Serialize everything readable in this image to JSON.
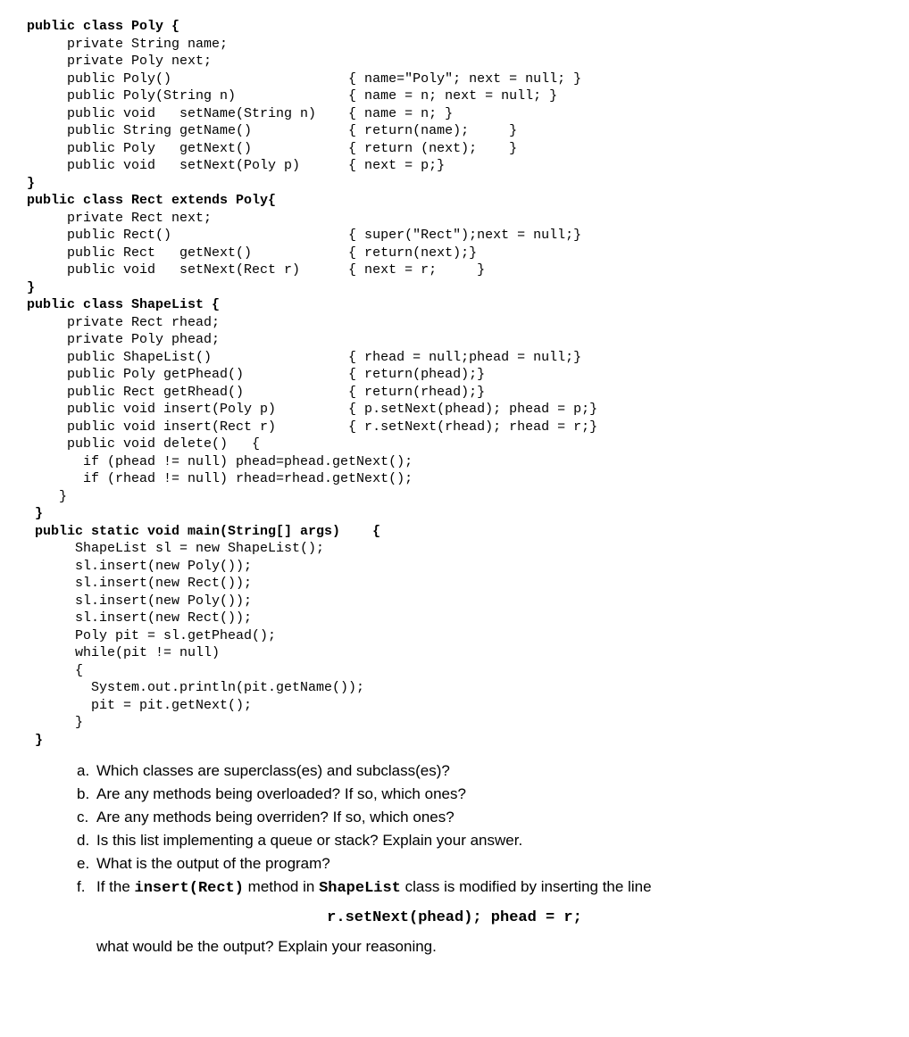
{
  "code": {
    "l1": "public class Poly {",
    "l2": "     private String name;",
    "l3": "     private Poly next;",
    "l4": "     public Poly()                      { name=\"Poly\"; next = null; }",
    "l5": "     public Poly(String n)              { name = n; next = null; }",
    "l6": "     public void   setName(String n)    { name = n; }",
    "l7": "     public String getName()            { return(name);     }",
    "l8": "     public Poly   getNext()            { return (next);    }",
    "l9": "     public void   setNext(Poly p)      { next = p;}",
    "l10": "}",
    "l11": "public class Rect extends Poly{",
    "l12": "     private Rect next;",
    "l13": "     public Rect()                      { super(\"Rect\");next = null;}",
    "l14": "     public Rect   getNext()            { return(next);}",
    "l15": "     public void   setNext(Rect r)      { next = r;     }",
    "l16": "}",
    "l17": "public class ShapeList {",
    "l18": "     private Rect rhead;",
    "l19": "     private Poly phead;",
    "l20": "     public ShapeList()                 { rhead = null;phead = null;}",
    "l21": "     public Poly getPhead()             { return(phead);}",
    "l22": "     public Rect getRhead()             { return(rhead);}",
    "l23": "     public void insert(Poly p)         { p.setNext(phead); phead = p;}",
    "l24": "     public void insert(Rect r)         { r.setNext(rhead); rhead = r;}",
    "l25": "     public void delete()   {",
    "l26": "       if (phead != null) phead=phead.getNext();",
    "l27": "       if (rhead != null) rhead=rhead.getNext();",
    "l28": "    }",
    "l29": " }",
    "l30": " public static void main(String[] args)    {",
    "l31": "      ShapeList sl = new ShapeList();",
    "l32": "      sl.insert(new Poly());",
    "l33": "      sl.insert(new Rect());",
    "l34": "      sl.insert(new Poly());",
    "l35": "      sl.insert(new Rect());",
    "l36": "      Poly pit = sl.getPhead();",
    "l37": "      while(pit != null)",
    "l38": "      {",
    "l39": "        System.out.println(pit.getName());",
    "l40": "        pit = pit.getNext();",
    "l41": "      }",
    "l42": " }"
  },
  "questions": {
    "a": {
      "letter": "a.",
      "text": "Which classes are superclass(es) and subclass(es)?"
    },
    "b": {
      "letter": "b.",
      "text": "Are any methods being overloaded? If so, which ones?"
    },
    "c": {
      "letter": "c.",
      "text": "Are any methods being overriden? If so, which ones?"
    },
    "d": {
      "letter": "d.",
      "text": "Is this list implementing a queue or stack? Explain your answer."
    },
    "e": {
      "letter": "e.",
      "text": "What is the output of the program?"
    },
    "f": {
      "letter": "f.",
      "pre": "If the ",
      "code1": "insert(Rect)",
      "mid": " method in ",
      "code2": "ShapeList",
      "post": " class is modified by inserting the line",
      "centered": "r.setNext(phead); phead = r;",
      "follow": "what would be the output? Explain your reasoning."
    }
  }
}
